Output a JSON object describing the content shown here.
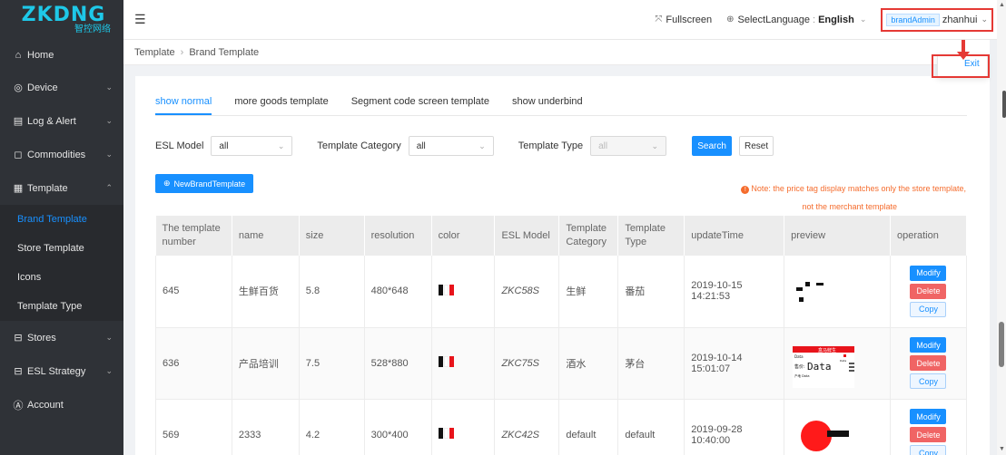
{
  "app": {
    "logo_main": "ZKDNG",
    "logo_sub": "智控网络"
  },
  "sidebar": {
    "items": [
      {
        "label": "Home",
        "icon": "home-icon"
      },
      {
        "label": "Device",
        "icon": "device-icon"
      },
      {
        "label": "Log & Alert",
        "icon": "log-icon"
      },
      {
        "label": "Commodities",
        "icon": "bag-icon"
      },
      {
        "label": "Template",
        "icon": "template-icon"
      },
      {
        "label": "Stores",
        "icon": "stores-icon"
      },
      {
        "label": "ESL Strategy",
        "icon": "strategy-icon"
      },
      {
        "label": "Account",
        "icon": "account-icon"
      }
    ],
    "template_sub": [
      "Brand Template",
      "Store Template",
      "Icons",
      "Template Type"
    ],
    "active_sub": "Brand Template"
  },
  "header": {
    "fullscreen": "Fullscreen",
    "select_language_label": "SelectLanguage",
    "language": "English",
    "user_role": "brandAdmin",
    "user_name": "zhanhui",
    "exit_label": "Exit"
  },
  "breadcrumb": {
    "root": "Template",
    "current": "Brand Template"
  },
  "tabs": [
    {
      "label": "show normal",
      "active": true
    },
    {
      "label": "more goods template",
      "active": false
    },
    {
      "label": "Segment code screen template",
      "active": false
    },
    {
      "label": "show underbind",
      "active": false
    }
  ],
  "filters": {
    "esl_model_label": "ESL Model",
    "esl_model_value": "all",
    "template_category_label": "Template Category",
    "template_category_value": "all",
    "template_type_label": "Template Type",
    "template_type_value": "all",
    "search_label": "Search",
    "reset_label": "Reset"
  },
  "new_button": "NewBrandTemplate",
  "note": {
    "line1": "Note: the price tag display matches only the store template,",
    "line2": "not the merchant template"
  },
  "table": {
    "columns": [
      "The template number",
      "name",
      "size",
      "resolution",
      "color",
      "ESL Model",
      "Template Category",
      "Template Type",
      "updateTime",
      "preview",
      "operation"
    ],
    "rows": [
      {
        "number": "645",
        "name": "生鲜百货",
        "size": "5.8",
        "resolution": "480*648",
        "model": "ZKC58S",
        "category": "生鲜",
        "type": "番茄",
        "update_time": "2019-10-15 14:21:53"
      },
      {
        "number": "636",
        "name": "产品培训",
        "size": "7.5",
        "resolution": "528*880",
        "model": "ZKC75S",
        "category": "酒水",
        "type": "茅台",
        "update_time": "2019-10-14 15:01:07"
      },
      {
        "number": "569",
        "name": "2333",
        "size": "4.2",
        "resolution": "300*400",
        "model": "ZKC42S",
        "category": "default",
        "type": "default",
        "update_time": "2019-09-28 10:40:00"
      }
    ],
    "ops": {
      "modify": "Modify",
      "delete": "Delete",
      "copy": "Copy"
    }
  },
  "preview_636": {
    "store": "盒马鲜生",
    "data_small": "Data",
    "price_label": "售价:",
    "data_big": "Data",
    "data_tag": "Data",
    "origin": "产地 Data"
  },
  "colors": {
    "accent": "#1890ff",
    "danger": "#f06464",
    "sidebar_bg": "#2f3237",
    "highlight": "#e53935"
  }
}
